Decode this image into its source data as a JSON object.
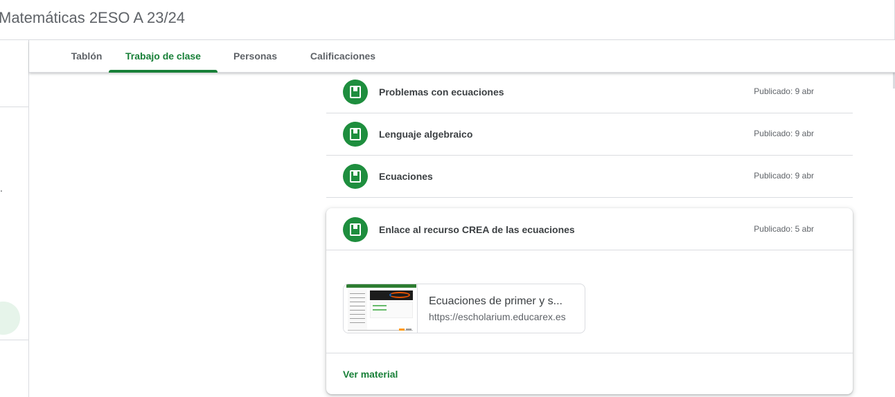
{
  "header": {
    "title": "Matemáticas 2ESO A 23/24"
  },
  "rail": {
    "dot": "."
  },
  "tabs": [
    {
      "label": "Tablón"
    },
    {
      "label": "Trabajo de clase",
      "active": true
    },
    {
      "label": "Personas"
    },
    {
      "label": "Calificaciones"
    }
  ],
  "colors": {
    "accent": "#188038",
    "icon_bg": "#1e8e3e",
    "divider": "#dadce0"
  },
  "materials": [
    {
      "title": "Problemas con ecuaciones",
      "date": "Publicado: 9 abr",
      "icon": "material-icon"
    },
    {
      "title": "Lenguaje algebraico",
      "date": "Publicado: 9 abr",
      "icon": "material-icon"
    },
    {
      "title": "Ecuaciones",
      "date": "Publicado: 9 abr",
      "icon": "material-icon"
    }
  ],
  "expanded": {
    "title": "Enlace al recurso CREA de las ecuaciones",
    "date": "Publicado: 5 abr",
    "icon": "material-icon",
    "link": {
      "title": "Ecuaciones de primer y s...",
      "url": "https://escholarium.educarex.es"
    },
    "view_label": "Ver material"
  }
}
